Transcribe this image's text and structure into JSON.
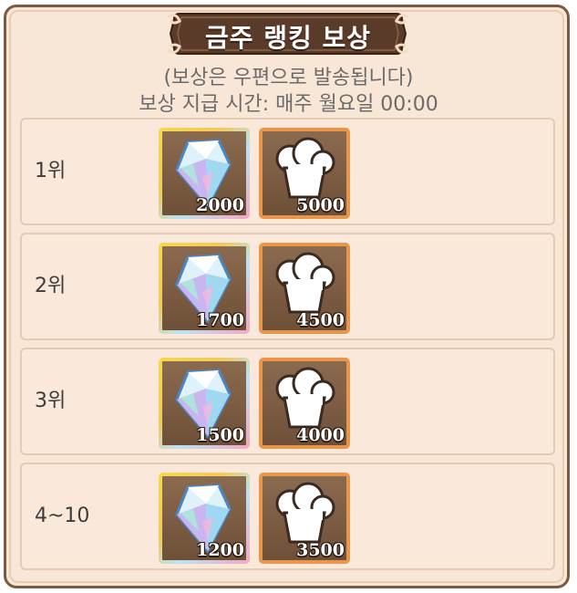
{
  "title": "금주 랭킹 보상",
  "subtitle_line1": "(보상은 우편으로 발송됩니다)",
  "subtitle_line2": "보상 지급 시간: 매주 월요일 00:00",
  "rewards": [
    {
      "rank": "1위",
      "gem_count": "2000",
      "hat_count": "5000"
    },
    {
      "rank": "2위",
      "gem_count": "1700",
      "hat_count": "4500"
    },
    {
      "rank": "3위",
      "gem_count": "1500",
      "hat_count": "4000"
    },
    {
      "rank": "4~10",
      "gem_count": "1200",
      "hat_count": "3500"
    }
  ],
  "icons": {
    "reward_1": "crystal-gem-icon",
    "reward_2": "chef-hat-icon"
  },
  "colors": {
    "panel_bg": "#f8e6d6",
    "banner": "#5a3a28",
    "frame_border": "#7a5a40",
    "hat_frame": "#e9964a"
  }
}
